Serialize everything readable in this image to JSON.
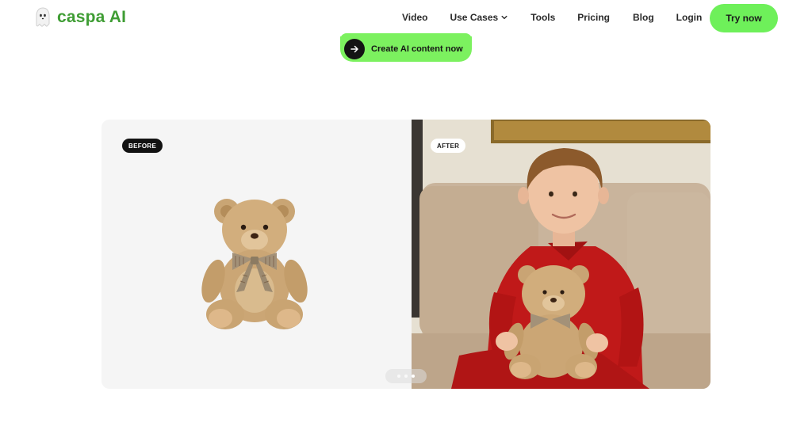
{
  "header": {
    "logo_text": "caspa AI",
    "nav": {
      "video": "Video",
      "use_cases": "Use Cases",
      "tools": "Tools",
      "pricing": "Pricing",
      "blog": "Blog",
      "login": "Login"
    },
    "try_now": "Try now"
  },
  "cta": {
    "label": "Create AI content now"
  },
  "comparison": {
    "before_label": "BEFORE",
    "after_label": "AFTER",
    "slide_count": 3,
    "active_slide": 2
  },
  "colors": {
    "brand_green": "#3f9d34",
    "button_green": "#6ef05a",
    "cta_green": "#7cf15f"
  },
  "icons": {
    "logo": "ghost-logo-icon",
    "dropdown": "chevron-down-icon",
    "cta": "arrow-right-icon"
  }
}
